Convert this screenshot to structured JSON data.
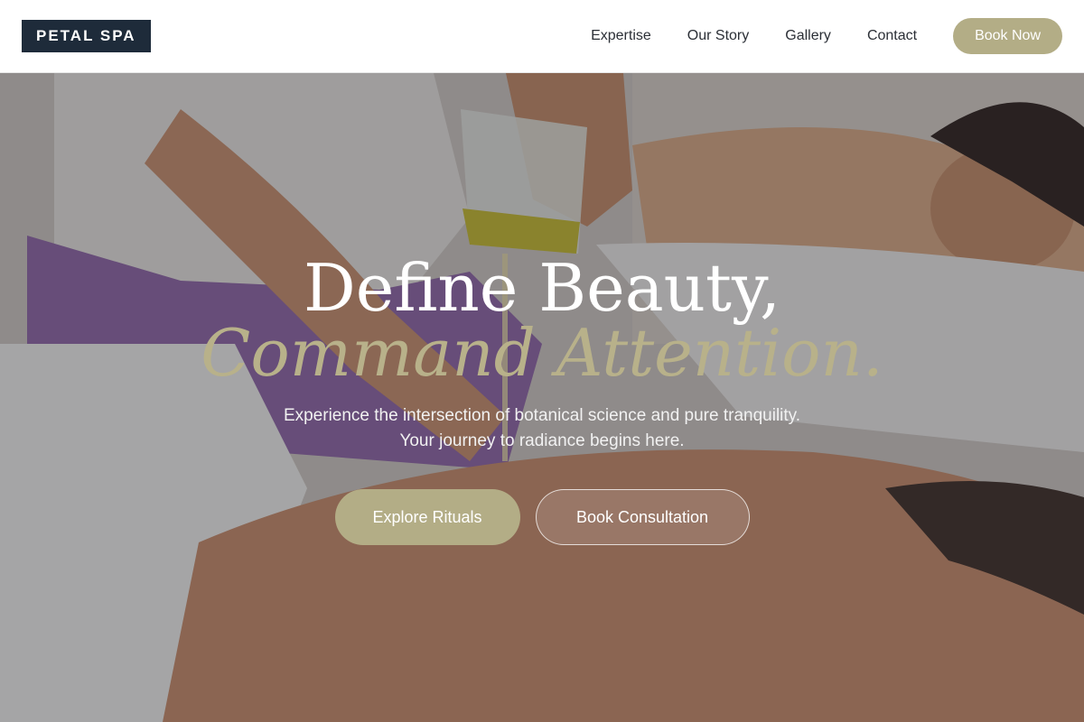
{
  "brand": {
    "logo_text": "PETAL SPA"
  },
  "nav": {
    "links": [
      {
        "label": "Expertise"
      },
      {
        "label": "Our Story"
      },
      {
        "label": "Gallery"
      },
      {
        "label": "Contact"
      }
    ],
    "cta_label": "Book Now"
  },
  "hero": {
    "headline": "Define Beauty,",
    "headline_accent": "Command Attention.",
    "subtext_line1": "Experience the intersection of botanical science and pure tranquility.",
    "subtext_line2": "Your journey to radiance begins here.",
    "primary_cta": "Explore Rituals",
    "secondary_cta": "Book Consultation",
    "background_image": "spa-massage-oil-photo"
  },
  "colors": {
    "brand_dark": "#1e2b3a",
    "accent": "#b3ad86",
    "accent_text": "#b8b18a",
    "nav_text": "#2b2f36"
  }
}
